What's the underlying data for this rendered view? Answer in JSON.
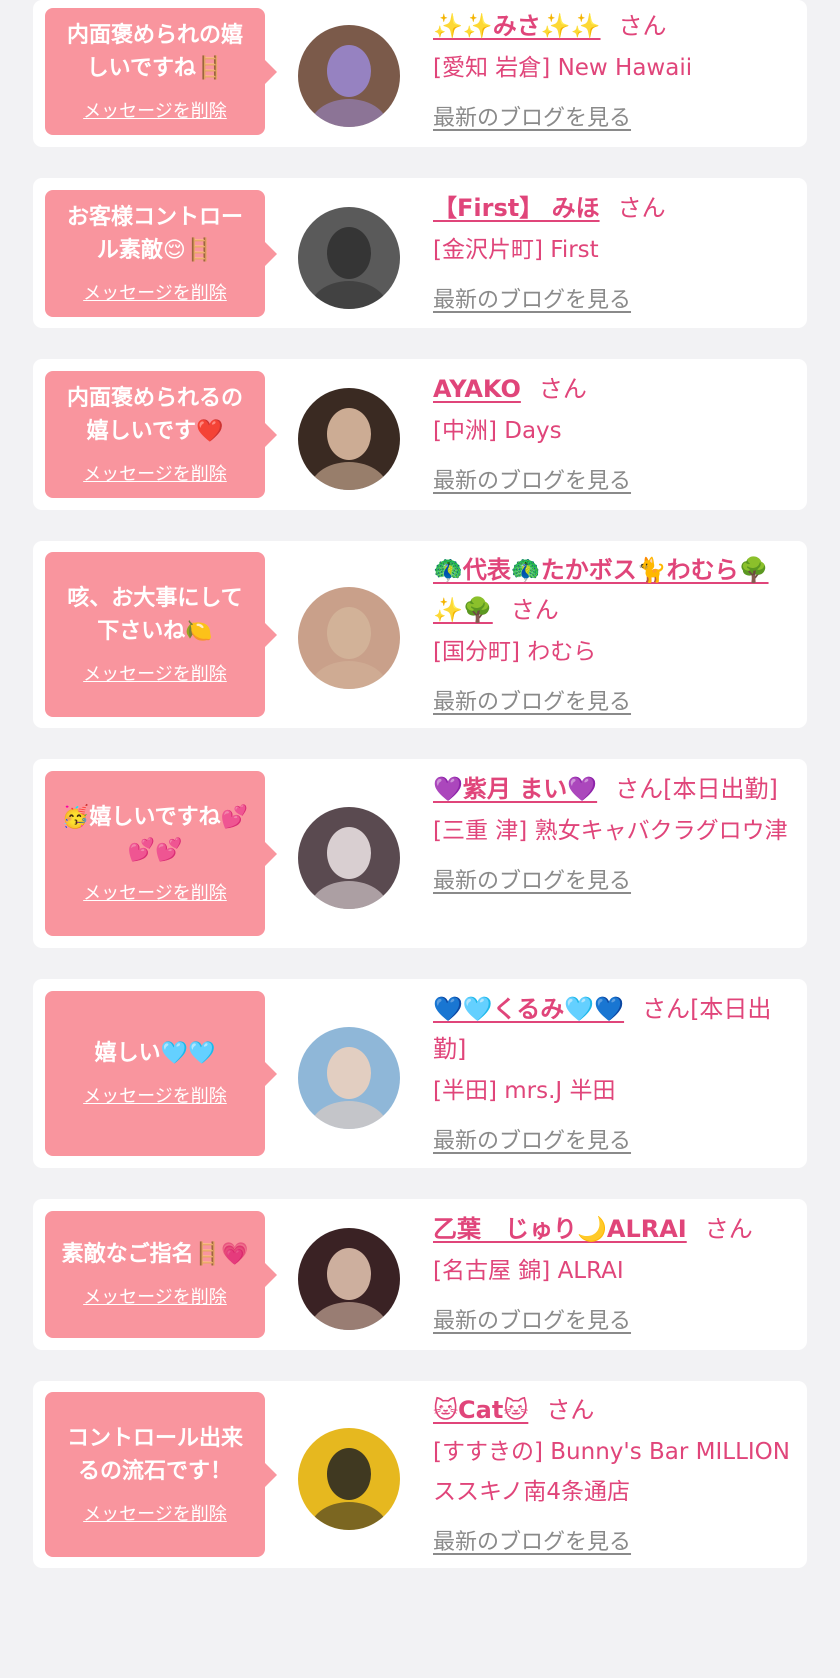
{
  "delete_label": "メッセージを削除",
  "blog_label": "最新のブログを見る",
  "honorific": "さん",
  "entries": [
    {
      "comment": "内面褒められの嬉\nしいですね🪜",
      "name": "✨✨みさ✨✨",
      "status": "",
      "shop": "[愛知 岩倉] New Hawaii",
      "avatar_color": "#7b5a4a",
      "avatar_accent": "#9b8ad6"
    },
    {
      "comment": "お客様コントロー\nル素敵😌🪜",
      "name": "【First】 みほ",
      "status": "",
      "shop": "[金沢片町] First",
      "avatar_color": "#5a5a5a",
      "avatar_accent": "#2f2f2f"
    },
    {
      "comment": "内面褒められるの\n嬉しいです❤️",
      "name": "AYAKO",
      "status": "",
      "shop": "[中洲] Days",
      "avatar_color": "#3a2a22",
      "avatar_accent": "#e6c3a8"
    },
    {
      "comment": "咳、お大事にして\n下さいね🍋",
      "name": "🦚代表🦚たかボス🐈わむら🌳✨🌳",
      "status": "",
      "shop": "[国分町] わむら",
      "avatar_color": "#c9a08a",
      "avatar_accent": "#d4b59a"
    },
    {
      "comment": "🥳嬉しいですね💕\n💕💕",
      "name": "💜紫月 まい💜",
      "status": "[本日出勤]",
      "shop": "[三重 津] 熟女キャバクラグロウ津",
      "avatar_color": "#5a4a50",
      "avatar_accent": "#f0e6e8"
    },
    {
      "comment": "嬉しい🩵🩵",
      "name": "💙🩵くるみ🩵💙",
      "status": "[本日出勤]",
      "shop": "[半田] mrs.J 半田",
      "avatar_color": "#8fb7d8",
      "avatar_accent": "#f1d2bd"
    },
    {
      "comment": "素敵なご指名🪜💗",
      "name": "乙葉　じゅり🌙ALRAI",
      "status": "",
      "shop": "[名古屋 錦] ALRAI",
      "avatar_color": "#3a2224",
      "avatar_accent": "#e8c8b4"
    },
    {
      "comment": "コントロール出来\nるの流石です！",
      "name": "🐱Cat🐱",
      "status": "",
      "shop": "[すすきの] Bunny's Bar MILLION ススキノ南4条通店",
      "avatar_color": "#e6b81f",
      "avatar_accent": "#222222"
    }
  ]
}
